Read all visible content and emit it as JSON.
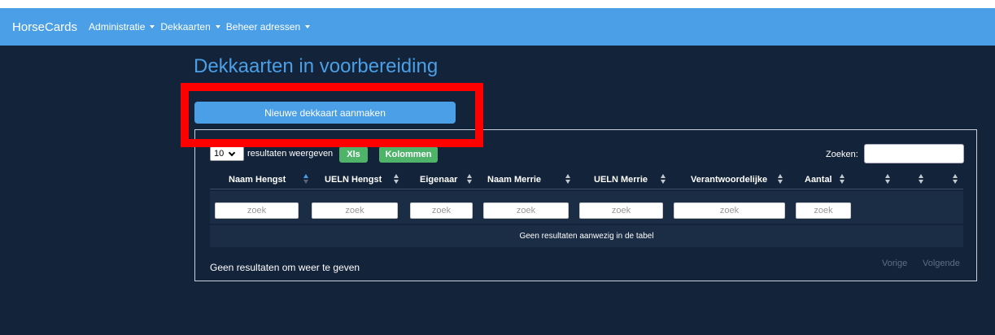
{
  "navbar": {
    "brand": "HorseCards",
    "menus": [
      "Administratie",
      "Dekkaarten",
      "Beheer adressen"
    ]
  },
  "page": {
    "title": "Dekkaarten in voorbereiding",
    "new_button": "Nieuwe dekkaart aanmaken"
  },
  "table_controls": {
    "length_value": "10",
    "length_label": "resultaten weergeven",
    "xls_button": "Xls",
    "columns_button": "Kolommen",
    "search_label": "Zoeken:",
    "search_value": ""
  },
  "table": {
    "columns": [
      "Naam Hengst",
      "UELN Hengst",
      "Eigenaar",
      "Naam Merrie",
      "UELN Merrie",
      "Verantwoordelijke",
      "Aantal",
      "",
      "",
      ""
    ],
    "filter_placeholder": "zoek",
    "empty_message": "Geen resultaten aanwezig in de tabel"
  },
  "footer": {
    "info": "Geen resultaten om weer te geven",
    "prev": "Vorige",
    "next": "Volgende"
  },
  "colors": {
    "background": "#13243a",
    "accent": "#4a9fe6",
    "success": "#4fb36a",
    "highlight": "#ff0000"
  }
}
